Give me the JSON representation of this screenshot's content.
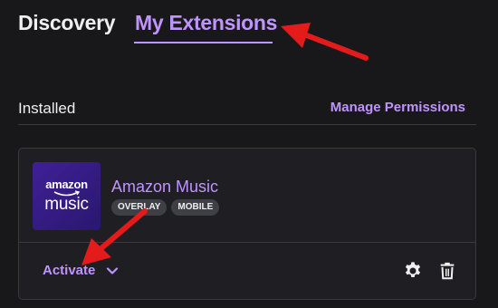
{
  "tabs": {
    "discovery": "Discovery",
    "my_extensions": "My Extensions"
  },
  "section": {
    "installed_label": "Installed",
    "manage_permissions": "Manage Permissions"
  },
  "extension": {
    "name": "Amazon Music",
    "logo_top": "amazon",
    "logo_bottom": "music",
    "badges": [
      "OVERLAY",
      "MOBILE"
    ],
    "activate_label": "Activate"
  },
  "icons": {
    "expand": "chevron-down-icon",
    "settings": "gear-icon",
    "delete": "trash-icon"
  },
  "colors": {
    "background": "#18181b",
    "card_background": "#1f1f23",
    "accent": "#bf94ff",
    "logo_background": "#3f2096",
    "badge_background": "#3f3f46",
    "annotation_arrow": "#e31b1b"
  }
}
